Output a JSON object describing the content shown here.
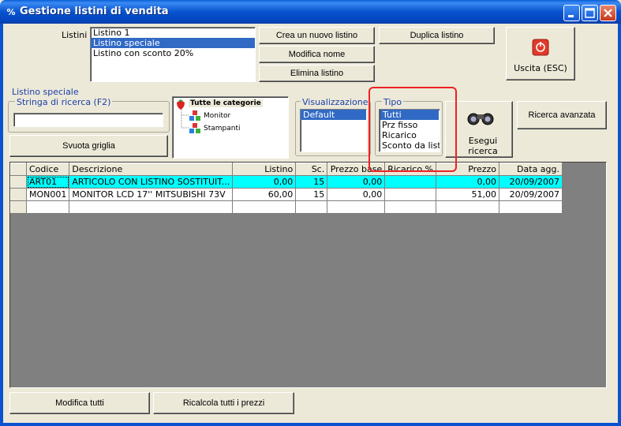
{
  "window": {
    "title": "Gestione listini di vendita",
    "icon": "%"
  },
  "listini": {
    "label": "Listini :",
    "items": [
      "Listino 1",
      "Listino speciale",
      "Listino con sconto 20%"
    ],
    "selected": 1
  },
  "buttons": {
    "crea": "Crea un nuovo listino",
    "duplica": "Duplica listino",
    "modifica_nome": "Modifica nome",
    "elimina": "Elimina listino",
    "uscita": "Uscita (ESC)",
    "svuota": "Svuota griglia",
    "ricerca_avanzata": "Ricerca avanzata",
    "esegui": "Esegui ricerca",
    "modifica_tutti": "Modifica tutti",
    "ricalcola": "Ricalcola tutti i prezzi"
  },
  "current_listino": "Listino speciale",
  "search": {
    "label": "Stringa di ricerca (F2)",
    "value": ""
  },
  "categories": {
    "root": "Tutte le categorie",
    "children": [
      "Monitor",
      "Stampanti"
    ]
  },
  "visualizzazione": {
    "label": "Visualizzazione",
    "items": [
      "Default"
    ],
    "selected": 0
  },
  "tipo": {
    "label": "Tipo",
    "items": [
      "Tutti",
      "Prz fisso",
      "Ricarico",
      "Sconto da listin"
    ],
    "selected": 0
  },
  "grid": {
    "columns": [
      "Codice",
      "Descrizione",
      "Listino",
      "Sc.",
      "Prezzo base",
      "Ricarico %",
      "Prezzo",
      "Data agg."
    ],
    "rows": [
      [
        "ART01",
        "ARTICOLO CON LISTINO SOSTITUIT...",
        "0,00",
        "15",
        "0,00",
        "",
        "0,00",
        "20/09/2007"
      ],
      [
        "MON001",
        "MONITOR LCD 17'' MITSUBISHI 73V",
        "60,00",
        "15",
        "0,00",
        "",
        "51,00",
        "20/09/2007"
      ]
    ]
  },
  "colors": {
    "titlebar": "#0853cf",
    "selection": "#316ac5",
    "active_row": "#00ffff",
    "highlight_box": "#ee2222",
    "exit_icon": "#e03a2a"
  },
  "icons": {
    "exit": "power-icon",
    "search": "binoculars-icon",
    "category_root": "strawberry-icon",
    "category_child": "cubes-icon"
  }
}
